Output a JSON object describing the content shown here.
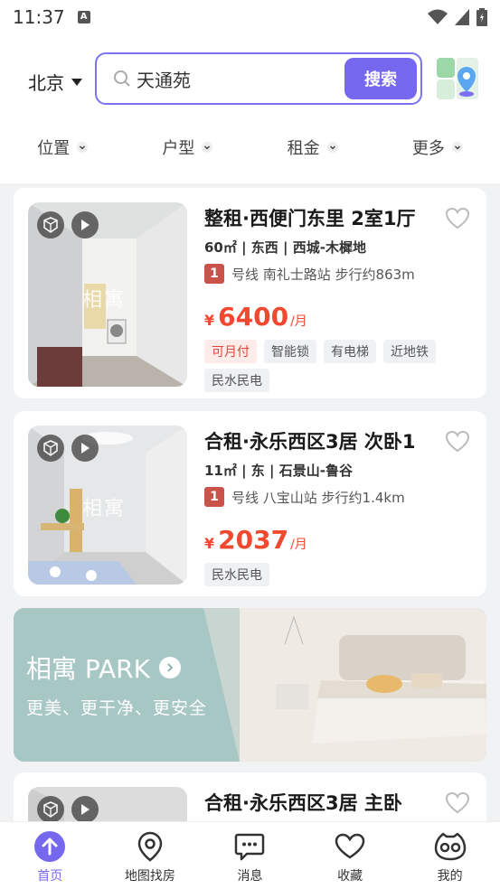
{
  "status": {
    "time": "11:37",
    "app_icon": "A"
  },
  "header": {
    "city": "北京",
    "search_value": "天通苑",
    "search_button": "搜索"
  },
  "filters": [
    {
      "label": "位置"
    },
    {
      "label": "户型"
    },
    {
      "label": "租金"
    },
    {
      "label": "更多"
    }
  ],
  "listings": [
    {
      "title": "整租·西便门东里 2室1厅",
      "subtitle": "60㎡ | 东西 | 西城-木樨地",
      "metro_line": "1",
      "metro_text": "号线  南礼士路站  步行约863m",
      "currency": "¥",
      "price": "6400",
      "unit": "/月",
      "tags": [
        "可月付",
        "智能锁",
        "有电梯",
        "近地铁",
        "民水民电"
      ],
      "watermark": "相寓"
    },
    {
      "title": "合租·永乐西区3居 次卧1",
      "subtitle": "11㎡ | 东 | 石景山-鲁谷",
      "metro_line": "1",
      "metro_text": "号线  八宝山站  步行约1.4km",
      "currency": "¥",
      "price": "2037",
      "unit": "/月",
      "tags": [
        "民水民电"
      ],
      "watermark": "相寓"
    },
    {
      "title": "合租·永乐西区3居 主卧"
    }
  ],
  "promo": {
    "title": "相寓 PARK",
    "subtitle": "更美、更干净、更安全"
  },
  "tabs": [
    {
      "label": "首页",
      "icon": "home-arrow-icon",
      "active": true
    },
    {
      "label": "地图找房",
      "icon": "map-pin-icon"
    },
    {
      "label": "消息",
      "icon": "message-icon"
    },
    {
      "label": "收藏",
      "icon": "heart-icon"
    },
    {
      "label": "我的",
      "icon": "profile-icon"
    }
  ],
  "colors": {
    "accent": "#7568ee",
    "price": "#f1482f",
    "metro": "#c9534b"
  }
}
